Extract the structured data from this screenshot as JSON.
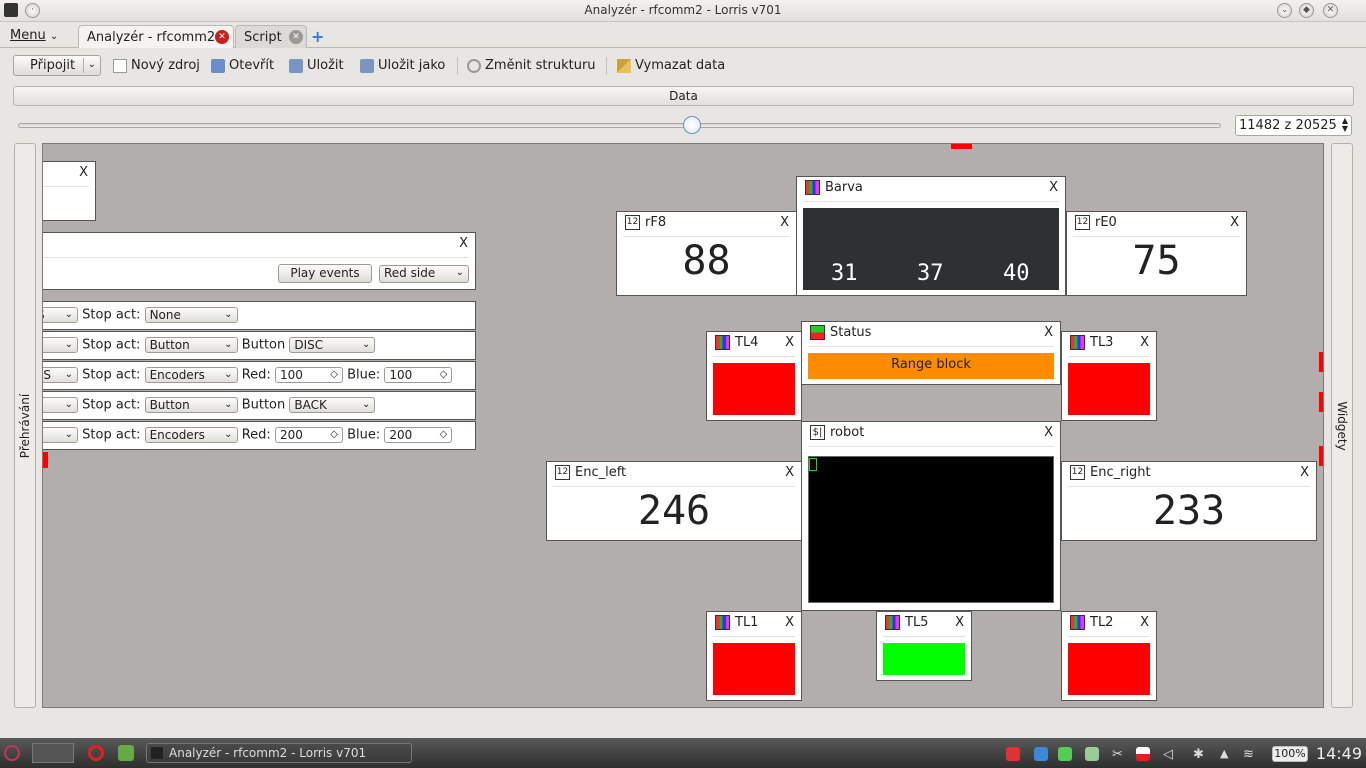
{
  "window": {
    "title": "Analyzér - rfcomm2 - Lorris v701"
  },
  "menubar": {
    "menu_label": "Menu"
  },
  "tabs": [
    {
      "label": "Analyzér - rfcomm2",
      "active": true
    },
    {
      "label": "Script",
      "active": false
    }
  ],
  "toolbar": {
    "connect_label": "Připojit",
    "new_source_label": "Nový zdroj",
    "open_label": "Otevřít",
    "save_label": "Uložit",
    "save_as_label": "Uložit jako",
    "change_structure_label": "Změnit strukturu",
    "clear_data_label": "Vymazat data"
  },
  "data_section": {
    "label": "Data"
  },
  "playback": {
    "position_text": "11482 z 20525",
    "slider_fraction": 0.56
  },
  "side_panels": {
    "left_label": "Přehrávání",
    "right_label": "Widgety"
  },
  "widgets": {
    "rF8": {
      "title": "rF8",
      "value": "88"
    },
    "rE0": {
      "title": "rE0",
      "value": "75"
    },
    "barva": {
      "title": "Barva",
      "values": [
        "31",
        "37",
        "40"
      ],
      "bg_color": "#2e3133"
    },
    "status": {
      "title": "Status",
      "text": "Range block",
      "color": "#ff8c00"
    },
    "robot": {
      "title": "robot"
    },
    "enc_left": {
      "title": "Enc_left",
      "value": "246"
    },
    "enc_right": {
      "title": "Enc_right",
      "value": "233"
    },
    "tl4": {
      "title": "TL4",
      "color": "#ff0000"
    },
    "tl3": {
      "title": "TL3",
      "color": "#ff0000"
    },
    "tl1": {
      "title": "TL1",
      "color": "#ff0000"
    },
    "tl5": {
      "title": "TL5",
      "color": "#00ff00"
    },
    "tl2": {
      "title": "TL2",
      "color": "#ff0000"
    },
    "close_label": "X",
    "number_icon_text": "12",
    "terminal_icon_text": "$|"
  },
  "script_panel": {
    "play_events_label": "Play events",
    "side_select_value": "Red side",
    "rows": [
      {
        "left_combo": "S",
        "stop_label": "Stop act:",
        "stop_value": "None"
      },
      {
        "left_combo": "",
        "stop_label": "Stop act:",
        "stop_value": "Button",
        "extra_label": "Button",
        "extra_value": "DISC"
      },
      {
        "left_combo": "RS",
        "stop_label": "Stop act:",
        "stop_value": "Encoders",
        "red_label": "Red:",
        "red_value": "100",
        "blue_label": "Blue:",
        "blue_value": "100"
      },
      {
        "left_combo": "",
        "stop_label": "Stop act:",
        "stop_value": "Button",
        "extra_label": "Button",
        "extra_value": "BACK"
      },
      {
        "left_combo": "",
        "stop_label": "Stop act:",
        "stop_value": "Encoders",
        "red_label": "Red:",
        "red_value": "200",
        "blue_label": "Blue:",
        "blue_value": "200"
      }
    ]
  },
  "taskbar": {
    "task_label": "Analyzér - rfcomm2 - Lorris v701",
    "battery": "100%",
    "clock": "14:49"
  }
}
